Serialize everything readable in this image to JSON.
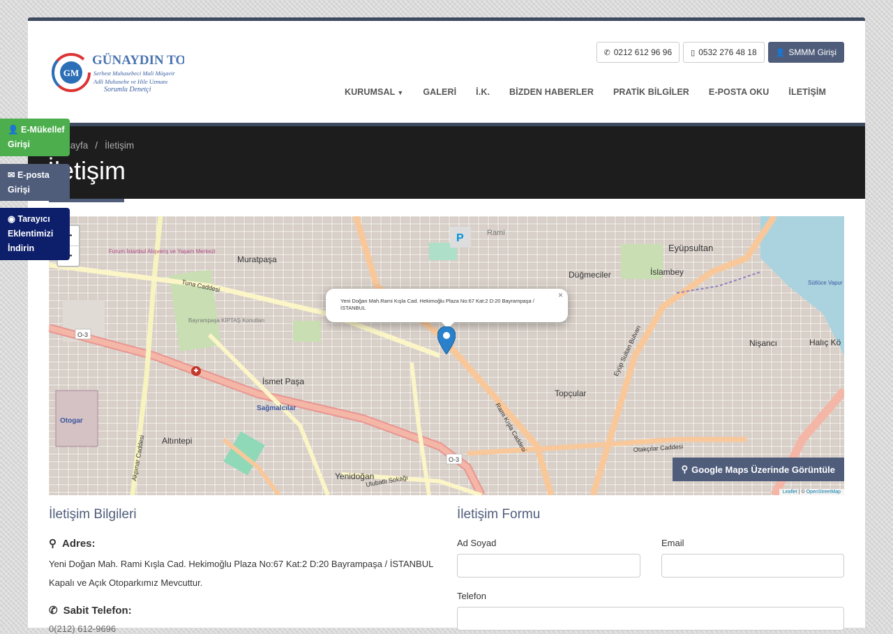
{
  "header": {
    "logo": {
      "title": "GÜNAYDIN TOPÇU",
      "line1": "Serbest Muhasebeci Mali Müşavir",
      "line2": "Adli Muhasebe ve Hile Uzmanı",
      "line3": "Sorumlu Denetçi",
      "monogram": "GM"
    },
    "phone1": "0212 612 96 96",
    "phone2": "0532 276 48 18",
    "smmm_login": "SMMM Girişi"
  },
  "nav": {
    "items": [
      {
        "label": "KURUMSAL"
      },
      {
        "label": "GALERİ"
      },
      {
        "label": "İ.K."
      },
      {
        "label": "BİZDEN HABERLER"
      },
      {
        "label": "PRATİK BİLGİLER"
      },
      {
        "label": "E-POSTA OKU"
      },
      {
        "label": "İLETİŞİM"
      }
    ]
  },
  "breadcrumb": {
    "home": "Anasayfa",
    "current": "İletişim"
  },
  "page_title": "İletişim",
  "map": {
    "zoom_in": "+",
    "zoom_out": "−",
    "popup_text": "Yeni Doğan Mah.Rami Kışla Cad. Hekimoğlu Plaza No:67 Kat:2 D:20 Bayrampaşa / İSTANBUL",
    "popup_close": "×",
    "gmaps_button": "Google Maps Üzerinde Görüntüle",
    "attribution_leaflet": "Leaflet",
    "attribution_sep": " | © ",
    "attribution_osm": "OpenStreetMap",
    "place_labels": [
      "Eyüpsultan",
      "Muratpaşa",
      "Düğmeciler",
      "İslambey",
      "İsmet Paşa",
      "Topçular",
      "Nişancı",
      "Altıntepi",
      "Yenidoğan",
      "Otogar",
      "Sağmalcılar",
      "Rami",
      "Halıç Kö",
      "Bayrampaşa KİPTAŞ Konutları",
      "Forum İstanbul Alışveriş ve Yaşam Merkezi",
      "Sütlüce Vapur İskelesi",
      "Tuna Caddesi",
      "Rami Kışla Caddesi",
      "Eyüp Sultan Bulvarı",
      "Otakçılar Caddesi",
      "Ulubatlı Sokağı",
      "Akpınar Caddesi",
      "O-3",
      "P"
    ]
  },
  "contact_info": {
    "title": "İletişim Bilgileri",
    "address_label": "Adres:",
    "address_line": "Yeni Doğan Mah. Rami Kışla Cad. Hekimoğlu Plaza No:67 Kat:2 D:20 Bayrampaşa / İSTANBUL",
    "parking_note": "Kapalı ve Açık Otoparkımız Mevcuttur.",
    "phone_label": "Sabit Telefon:",
    "phone_value": "0(212) 612-9696"
  },
  "contact_form": {
    "title": "İletişim Formu",
    "name_label": "Ad Soyad",
    "email_label": "Email",
    "phone_label": "Telefon"
  },
  "side_tabs": {
    "emukellef": "E-Mükellef Girişi",
    "eposta": "E-posta Girişi",
    "tarayici": "Tarayıcı Eklentimizi İndirin"
  },
  "colors": {
    "brand": "#4f5d7b",
    "green": "#4cae4c",
    "navy": "#0d1f6b",
    "dark_band": "#1d1d1d"
  }
}
